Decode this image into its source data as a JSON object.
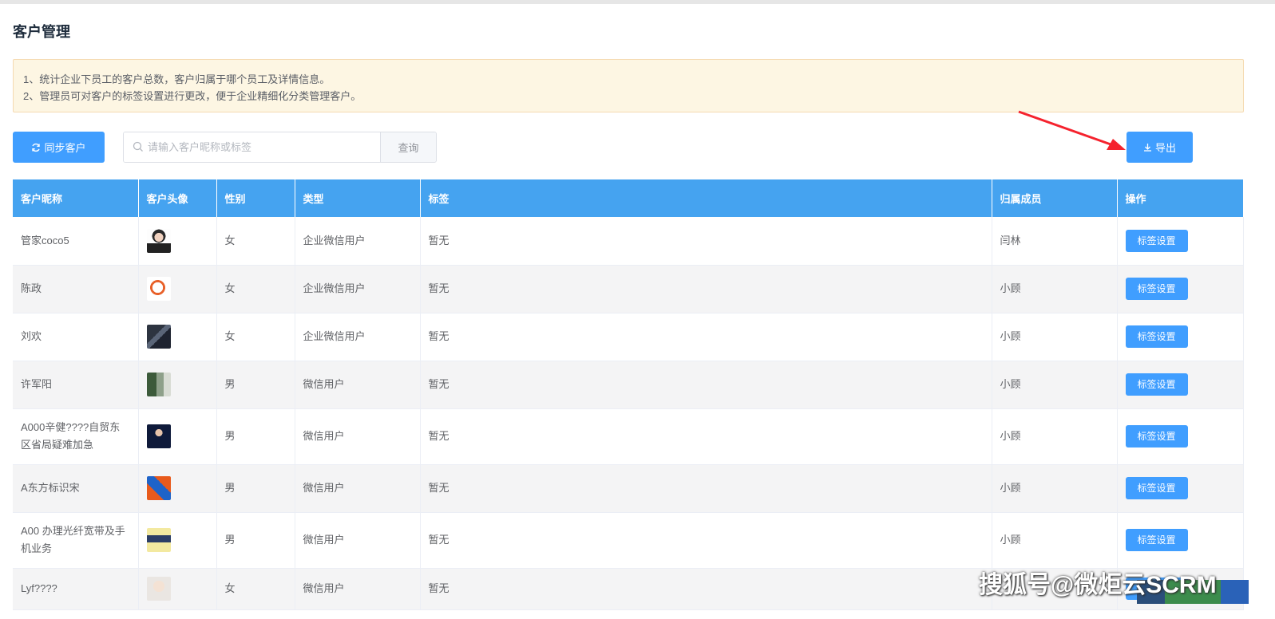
{
  "page": {
    "title": "客户管理"
  },
  "notice": {
    "lines": [
      "1、统计企业下员工的客户总数，客户归属于哪个员工及详情信息。",
      "2、管理员可对客户的标签设置进行更改，便于企业精细化分类管理客户。"
    ]
  },
  "toolbar": {
    "sync_label": "同步客户",
    "search_placeholder": "请输入客户昵称或标签",
    "query_label": "查询",
    "export_label": "导出"
  },
  "table": {
    "columns": [
      "客户昵称",
      "客户头像",
      "性别",
      "类型",
      "标签",
      "归属成员",
      "操作"
    ],
    "action_label": "标签设置",
    "rows": [
      {
        "nickname": "管家coco5",
        "avatar": "portrait-woman",
        "gender": "女",
        "type": "企业微信用户",
        "tags": "暂无",
        "owner": "闫林"
      },
      {
        "nickname": "陈政",
        "avatar": "logo-red-orange",
        "gender": "女",
        "type": "企业微信用户",
        "tags": "暂无",
        "owner": "小顾"
      },
      {
        "nickname": "刘欢",
        "avatar": "photo-dark",
        "gender": "女",
        "type": "企业微信用户",
        "tags": "暂无",
        "owner": "小顾"
      },
      {
        "nickname": "许军阳",
        "avatar": "photo-plant",
        "gender": "男",
        "type": "微信用户",
        "tags": "暂无",
        "owner": "小顾"
      },
      {
        "nickname": "A000辛健????自贸东区省局疑难加急",
        "avatar": "portrait-suit",
        "gender": "男",
        "type": "微信用户",
        "tags": "暂无",
        "owner": "小顾"
      },
      {
        "nickname": "A东方标识宋",
        "avatar": "logo-diamond",
        "gender": "男",
        "type": "微信用户",
        "tags": "暂无",
        "owner": "小顾"
      },
      {
        "nickname": "A00 办理光纤宽带及手机业务",
        "avatar": "sign-yellow",
        "gender": "男",
        "type": "微信用户",
        "tags": "暂无",
        "owner": "小顾"
      },
      {
        "nickname": "Lyf????",
        "avatar": "portrait-light",
        "gender": "女",
        "type": "微信用户",
        "tags": "暂无",
        "owner": ""
      }
    ]
  },
  "watermark": {
    "text": "搜狐号@微炬云SCRM"
  },
  "colors": {
    "primary": "#409eff",
    "header": "#45a3f0",
    "notice_bg": "#fdf6e3",
    "arrow": "#f5222d"
  }
}
